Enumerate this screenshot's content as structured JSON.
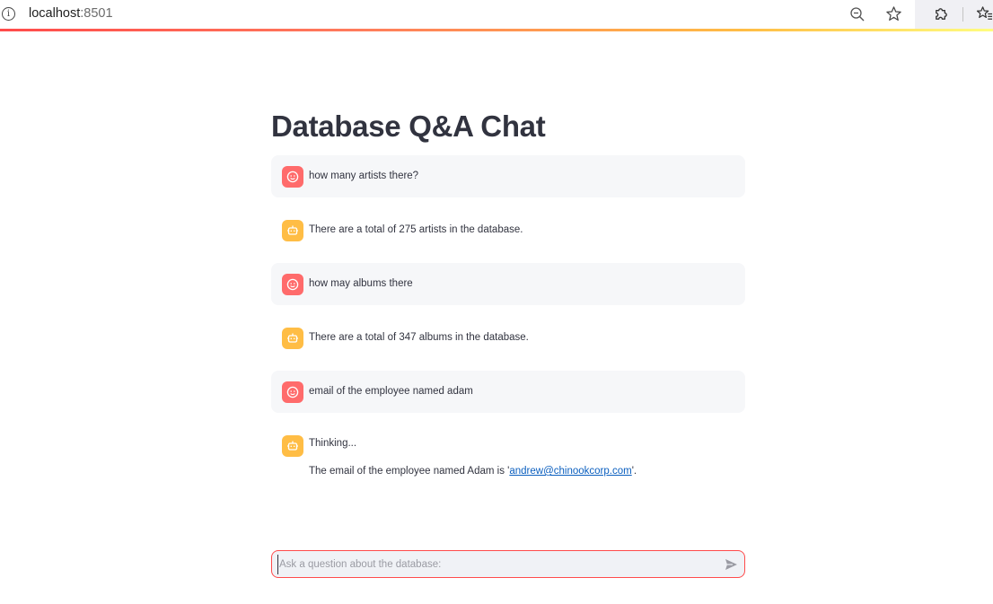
{
  "browser": {
    "url_host": "localhost",
    "url_port": ":8501",
    "info_icon": "i"
  },
  "page": {
    "title": "Database Q&A Chat"
  },
  "messages": [
    {
      "role": "user",
      "avatar_icon": "user-face-icon",
      "text": "how many artists there?"
    },
    {
      "role": "assistant",
      "avatar_icon": "robot-icon",
      "text": "There are a total of 275 artists in the database."
    },
    {
      "role": "user",
      "avatar_icon": "user-face-icon",
      "text": "how may albums there"
    },
    {
      "role": "assistant",
      "avatar_icon": "robot-icon",
      "text": "There are a total of 347 albums in the database."
    },
    {
      "role": "user",
      "avatar_icon": "user-face-icon",
      "text": "email of the employee named adam"
    },
    {
      "role": "assistant",
      "avatar_icon": "robot-icon",
      "status": "Thinking...",
      "answer_prefix": "The email of the employee named Adam is '",
      "answer_link": "andrew@chinookcorp.com",
      "answer_suffix": "'."
    }
  ],
  "chat_input": {
    "placeholder": "Ask a question about the database:",
    "value": ""
  },
  "colors": {
    "user_avatar": "#ff6b6b",
    "assistant_avatar": "#ffbd45",
    "accent": "#ff4b4b",
    "link": "#0b5fbf"
  }
}
